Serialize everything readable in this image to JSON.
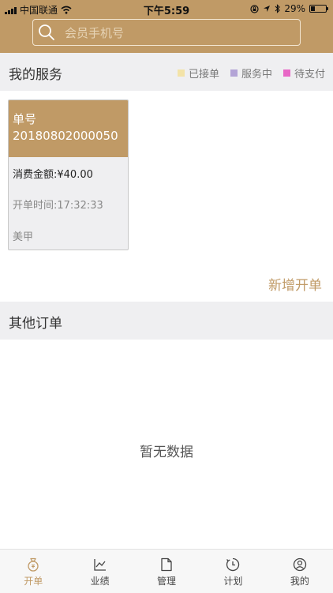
{
  "status_bar": {
    "carrier": "中国联通",
    "time": "下午5:59",
    "battery": "29%",
    "battery_level": 0.29
  },
  "search": {
    "placeholder": "会员手机号"
  },
  "my_services": {
    "title": "我的服务",
    "legend": [
      {
        "label": "已接单",
        "color": "#f3e3a8"
      },
      {
        "label": "服务中",
        "color": "#b3a4d6"
      },
      {
        "label": "待支付",
        "color": "#e868c6"
      }
    ],
    "orders": [
      {
        "order_label": "单号",
        "order_number": "20180802000050",
        "amount": "消费金额:¥40.00",
        "open_time": "开单时间:17:32:33",
        "service": "美甲"
      }
    ],
    "add_order_label": "新增开单"
  },
  "other_orders": {
    "title": "其他订单",
    "empty_text": "暂无数据"
  },
  "tab_bar": {
    "tabs": [
      {
        "label": "开单",
        "icon": "bag-icon",
        "active": true
      },
      {
        "label": "业绩",
        "icon": "chart-icon",
        "active": false
      },
      {
        "label": "管理",
        "icon": "document-icon",
        "active": false
      },
      {
        "label": "计划",
        "icon": "clock-icon",
        "active": false
      },
      {
        "label": "我的",
        "icon": "profile-icon",
        "active": false
      }
    ]
  },
  "colors": {
    "brand": "#c09a66",
    "section_bg": "#efeff1"
  }
}
